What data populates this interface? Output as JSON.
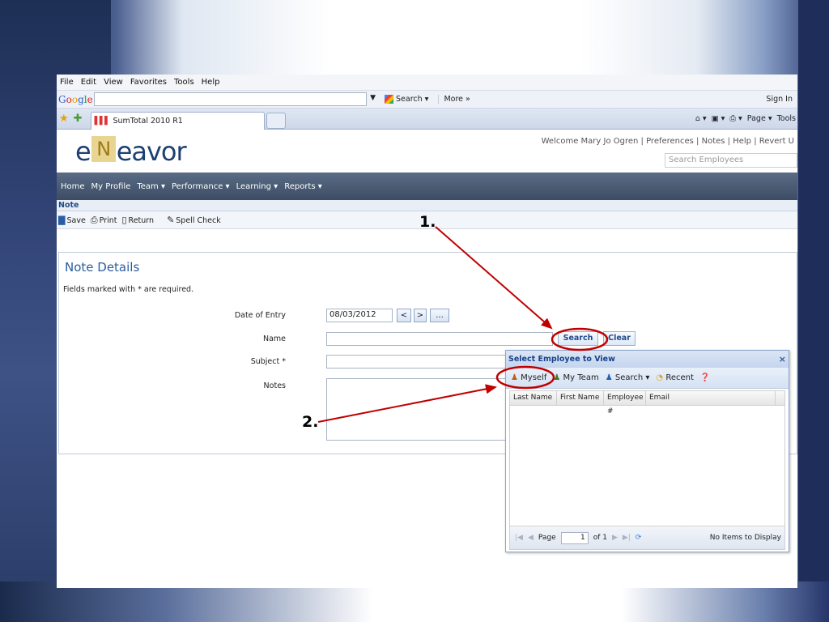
{
  "browser": {
    "menu": [
      "File",
      "Edit",
      "View",
      "Favorites",
      "Tools",
      "Help"
    ],
    "google": {
      "logo": "Google",
      "search_label": "Search ▾",
      "more_label": "More »",
      "sign_in": "Sign In"
    },
    "tab_title": "SumTotal 2010 R1",
    "command_bar": [
      "Page ▾",
      "Tools"
    ]
  },
  "app": {
    "logo_left": "e",
    "logo_mid": "N",
    "logo_right": "eavor",
    "welcome": "Welcome Mary Jo Ogren  |  Preferences | Notes | Help | Revert U",
    "search_employees_placeholder": "Search Employees",
    "nav": [
      "Home",
      "My Profile",
      "Team ▾",
      "Performance ▾",
      "Learning ▾",
      "Reports ▾"
    ],
    "page_title": "Note",
    "toolbar": {
      "save": "Save",
      "print": "Print",
      "return": "Return",
      "spell": "Spell Check"
    }
  },
  "form": {
    "heading": "Note Details",
    "required_note": "Fields marked with * are required.",
    "date_label": "Date of Entry",
    "date_value": "08/03/2012",
    "date_prev": "<",
    "date_next": ">",
    "date_pick": "...",
    "name_label": "Name",
    "name_value": "",
    "search_button": "Search",
    "clear_button": "Clear",
    "subject_label": "Subject *",
    "notes_label": "Notes"
  },
  "dialog": {
    "title": "Select Employee to View",
    "close": "×",
    "tools": {
      "myself": "Myself",
      "my_team": "My Team",
      "search": "Search ▾",
      "recent": "Recent"
    },
    "columns": [
      "Last Name",
      "First Name",
      "Employee #",
      "Email"
    ],
    "pager": {
      "page_label": "Page",
      "page_value": "1",
      "of_label": "of 1",
      "status": "No Items to Display"
    }
  },
  "annotations": {
    "step1": "1.",
    "step2": "2."
  },
  "colors": {
    "annotation_red": "#c00000",
    "nav_bg": "#45556f",
    "heading_blue": "#2a5c9f"
  }
}
